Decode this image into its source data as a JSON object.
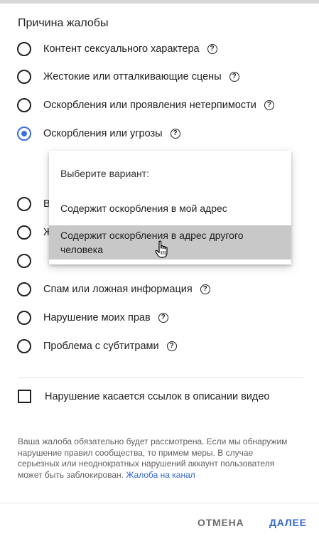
{
  "dialog": {
    "title": "Причина жалобы",
    "options": [
      {
        "label": "Контент сексуального характера",
        "help": "?",
        "checked": false
      },
      {
        "label": "Жестокие или отталкивающие сцены",
        "help": "?",
        "checked": false
      },
      {
        "label": "Оскорбления или проявления нетерпимости",
        "help": "?",
        "checked": false
      },
      {
        "label": "Оскорбления или угрозы",
        "help": "?",
        "checked": true
      },
      {
        "label": "В",
        "help": "",
        "checked": false
      },
      {
        "label": "Ж",
        "help": "",
        "checked": false
      },
      {
        "label": "",
        "help": "",
        "checked": false
      },
      {
        "label": "Спам или ложная информация",
        "help": "?",
        "checked": false
      },
      {
        "label": "Нарушение моих прав",
        "help": "?",
        "checked": false
      },
      {
        "label": "Проблема с субтитрами",
        "help": "?",
        "checked": false
      }
    ],
    "dropdown": {
      "prompt": "Выберите вариант:",
      "items": [
        "Содержит оскорбления в мой адрес",
        "Содержит оскорбления в адрес другого человека"
      ],
      "highlighted_index": 1
    },
    "checkbox": {
      "label": "Нарушение касается ссылок в описании видео",
      "checked": false
    },
    "notice": {
      "text": "Ваша жалоба обязательно будет рассмотрена. Если мы обнаружим нарушение правил сообщества, то примем меры. В случае серьезных или неоднократных нарушений аккаунт пользователя может быть заблокирован.",
      "link": "Жалоба на канал"
    },
    "buttons": {
      "cancel": "ОТМЕНА",
      "next": "ДАЛЕЕ"
    }
  },
  "colors": {
    "accent": "#3d6fd6",
    "link": "#3366cc",
    "highlight": "#c8c8c8"
  },
  "icons": {
    "help": "help-circle-icon",
    "cursor": "hand-pointer-icon"
  }
}
